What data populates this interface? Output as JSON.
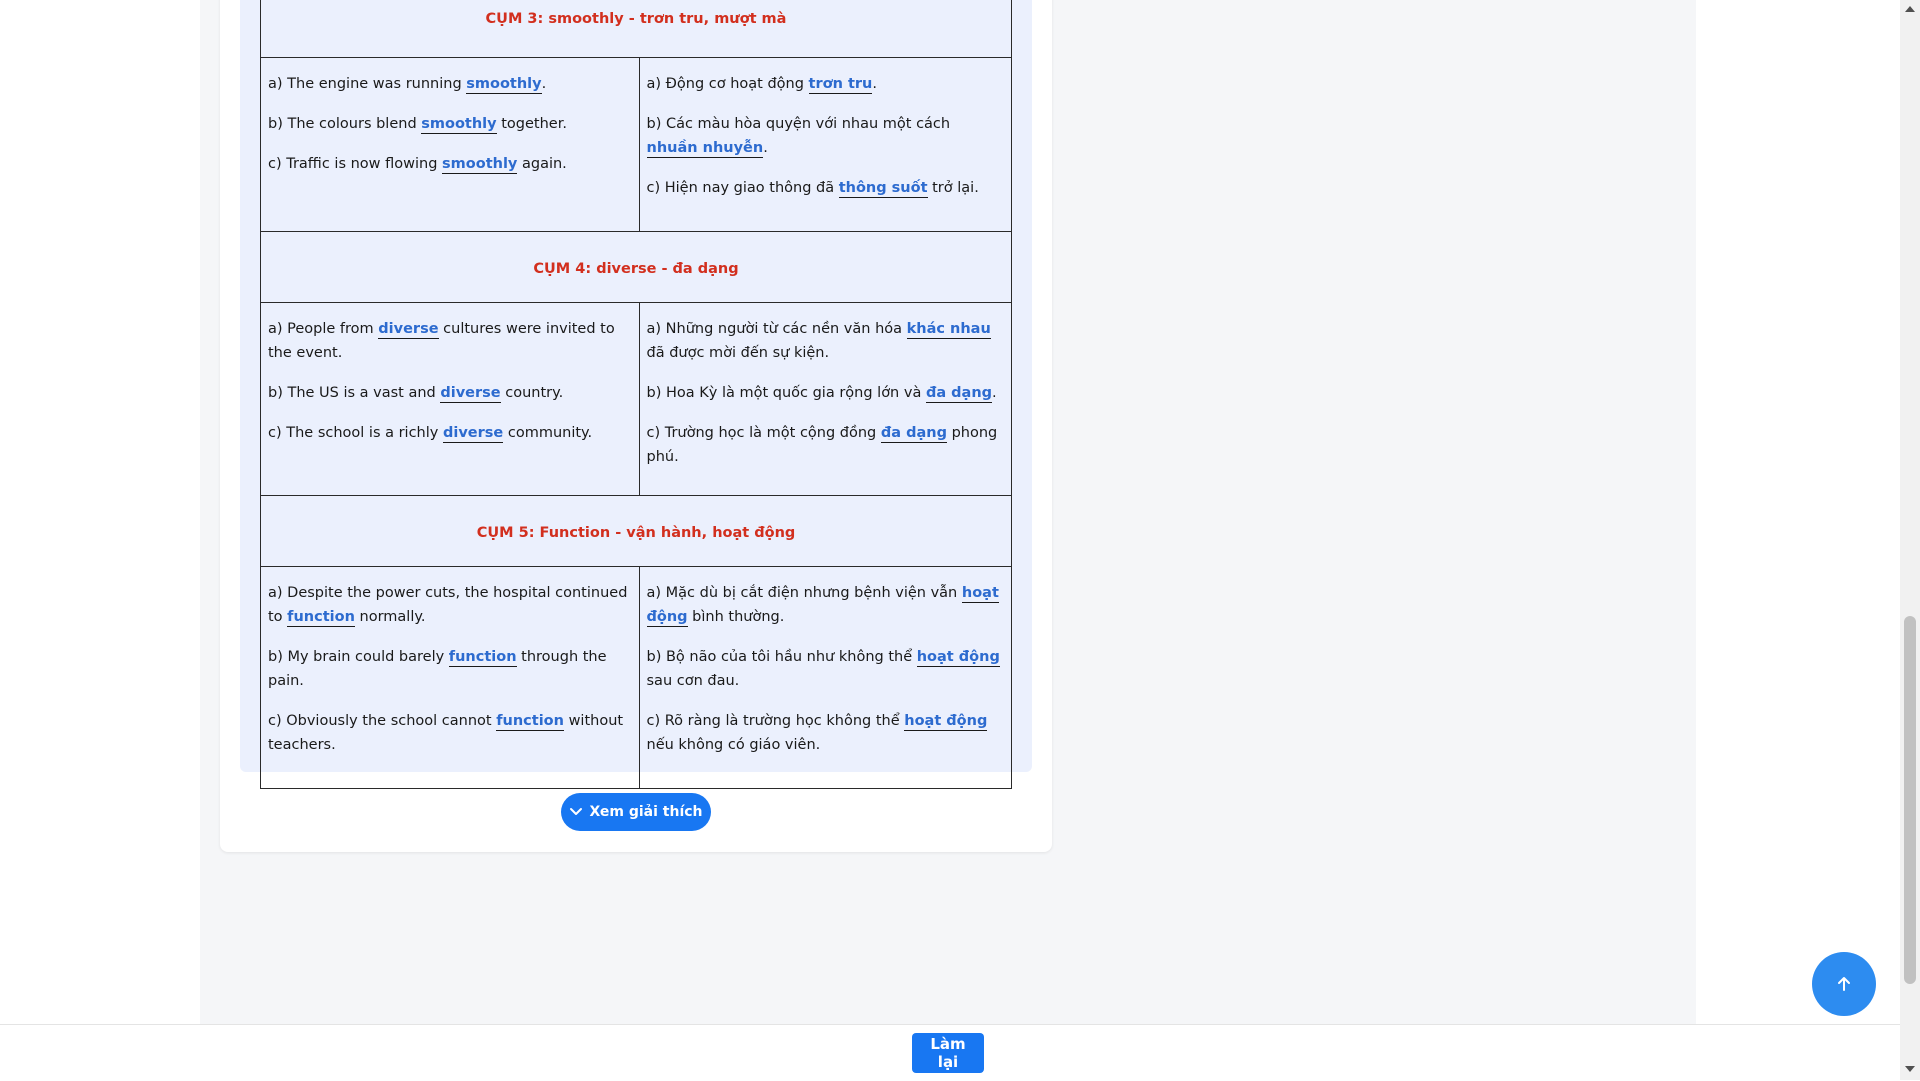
{
  "groups": [
    {
      "title": "CỤM 3: smoothly - trơn tru, mượt mà",
      "en": [
        {
          "pre": "a) The engine was running ",
          "kw": "smoothly",
          "post": "."
        },
        {
          "pre": "b) The colours blend ",
          "kw": "smoothly",
          "post": " together."
        },
        {
          "pre": "c) Traffic is now flowing ",
          "kw": "smoothly",
          "post": " again."
        }
      ],
      "vi": [
        {
          "pre": "a) Động cơ hoạt động ",
          "kw": "trơn tru",
          "post": "."
        },
        {
          "pre": "b) Các màu hòa quyện với nhau một cách ",
          "kw": "nhuần nhuyễn",
          "post": "."
        },
        {
          "pre": "c) Hiện nay giao thông đã ",
          "kw": "thông suốt",
          "post": " trở lại."
        }
      ]
    },
    {
      "title": "CỤM 4: diverse - đa dạng",
      "en": [
        {
          "pre": "a) People from ",
          "kw": "diverse",
          "post": " cultures were invited to the event."
        },
        {
          "pre": "b) The US is a vast and ",
          "kw": "diverse",
          "post": " country."
        },
        {
          "pre": "c) The school is a richly ",
          "kw": "diverse",
          "post": " community."
        }
      ],
      "vi": [
        {
          "pre": "a) Những người từ các nền văn hóa ",
          "kw": "khác nhau",
          "post": " đã được mời đến sự kiện."
        },
        {
          "pre": "b) Hoa Kỳ là một quốc gia rộng lớn và ",
          "kw": "đa dạng",
          "post": "."
        },
        {
          "pre": "c) Trường học là một cộng đồng ",
          "kw": "đa dạng",
          "post": " phong phú."
        }
      ]
    },
    {
      "title": "CỤM 5: Function - vận hành, hoạt động",
      "en": [
        {
          "pre": "a) Despite the power cuts, the hospital continued to ",
          "kw": "function",
          "post": " normally."
        },
        {
          "pre": "b) My brain could barely ",
          "kw": "function",
          "post": " through the pain."
        },
        {
          "pre": "c) Obviously the school cannot ",
          "kw": "function",
          "post": " without teachers."
        }
      ],
      "vi": [
        {
          "pre": "a) Mặc dù bị cắt điện nhưng bệnh viện vẫn ",
          "kw": "hoạt động",
          "post": " bình thường."
        },
        {
          "pre": "b) Bộ não của tôi hầu như không thể ",
          "kw": "hoạt động",
          "post": " sau cơn đau."
        },
        {
          "pre": "c) Rõ ràng là trường học không thể ",
          "kw": "hoạt động",
          "post": " nếu không có giáo viên."
        }
      ]
    }
  ],
  "explain_button": {
    "label": "Xem giải thích",
    "icon": "chevron-down-icon"
  },
  "redo_button": {
    "label": "Làm lại"
  },
  "scroll_top_button": {
    "icon": "arrow-up-icon"
  },
  "colors": {
    "accent": "#1877f2",
    "group_title": "#d22f1e",
    "keyword": "#2d6bcf",
    "panel": "#ebf0fd"
  }
}
